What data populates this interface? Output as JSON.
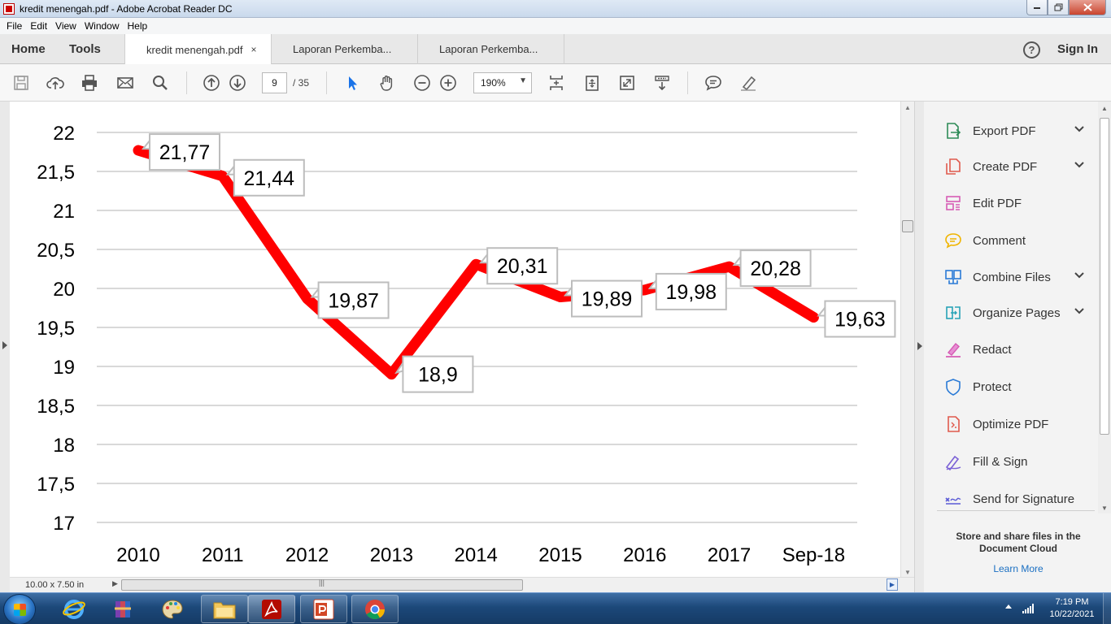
{
  "window": {
    "title": "kredit menengah.pdf - Adobe Acrobat Reader DC"
  },
  "menu": [
    "File",
    "Edit",
    "View",
    "Window",
    "Help"
  ],
  "nav": {
    "home": "Home",
    "tools": "Tools",
    "sign_in": "Sign In",
    "help_symbol": "?"
  },
  "tabs": [
    {
      "label": "kredit menengah.pdf",
      "close": "×"
    },
    {
      "label": "Laporan Perkemba..."
    },
    {
      "label": "Laporan Perkemba..."
    }
  ],
  "toolbar": {
    "page_current": "9",
    "page_total": "/ 35",
    "zoom": "190%"
  },
  "status": {
    "page_dims": "10.00 x 7.50 in"
  },
  "chart_data": {
    "type": "line",
    "categories": [
      "2010",
      "2011",
      "2012",
      "2013",
      "2014",
      "2015",
      "2016",
      "2017",
      "Sep-18"
    ],
    "values": [
      21.77,
      21.44,
      19.87,
      18.9,
      20.31,
      19.89,
      19.98,
      20.28,
      19.63
    ],
    "data_labels": [
      "21,77",
      "21,44",
      "19,87",
      "18,9",
      "20,31",
      "19,89",
      "19,98",
      "20,28",
      "19,63"
    ],
    "y_ticks": [
      "17",
      "17,5",
      "18",
      "18,5",
      "19",
      "19,5",
      "20",
      "20,5",
      "21",
      "21,5",
      "22"
    ],
    "ylim": [
      17,
      22
    ],
    "grid": true,
    "line_color": "#ff0000"
  },
  "right_pane": {
    "tools": [
      {
        "label": "Export PDF",
        "icon": "export-pdf-icon",
        "expandable": true
      },
      {
        "label": "Create PDF",
        "icon": "create-pdf-icon",
        "expandable": true
      },
      {
        "label": "Edit PDF",
        "icon": "edit-pdf-icon"
      },
      {
        "label": "Comment",
        "icon": "comment-icon"
      },
      {
        "label": "Combine Files",
        "icon": "combine-files-icon",
        "expandable": true
      },
      {
        "label": "Organize Pages",
        "icon": "organize-pages-icon",
        "expandable": true
      },
      {
        "label": "Redact",
        "icon": "redact-icon"
      },
      {
        "label": "Protect",
        "icon": "protect-icon"
      },
      {
        "label": "Optimize PDF",
        "icon": "optimize-pdf-icon"
      },
      {
        "label": "Fill & Sign",
        "icon": "fill-sign-icon"
      },
      {
        "label": "Send for Signature",
        "icon": "send-signature-icon"
      }
    ],
    "cloud_text": "Store and share files in the Document Cloud",
    "learn_more": "Learn More"
  },
  "taskbar": {
    "time": "7:19 PM",
    "date": "10/22/2021"
  }
}
